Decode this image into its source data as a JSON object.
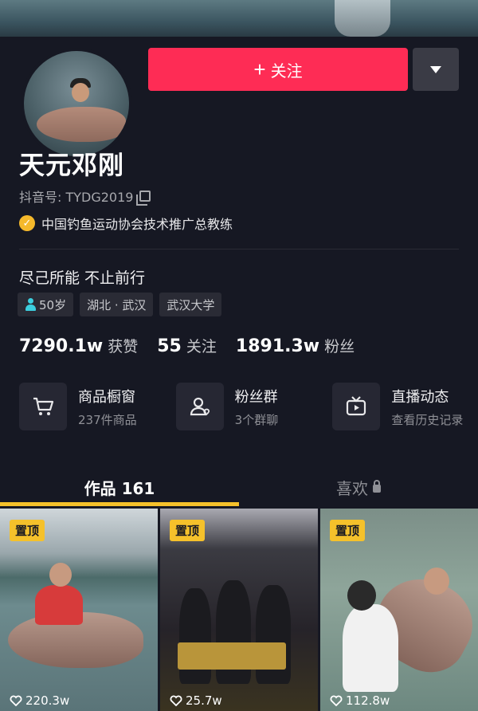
{
  "profile": {
    "name": "天元邓刚",
    "douyin_id": "抖音号: TYDG2019",
    "verification": "中国钓鱼运动协会技术推广总教练",
    "bio": "尽己所能 不止前行",
    "tags": [
      {
        "label": "50岁",
        "icon": "person-icon"
      },
      {
        "label": "湖北 · 武汉"
      },
      {
        "label": "武汉大学"
      }
    ]
  },
  "actions": {
    "follow_label": "关注",
    "follow_plus": "+"
  },
  "stats": [
    {
      "value": "7290.1w",
      "label": "获赞"
    },
    {
      "value": "55",
      "label": "关注"
    },
    {
      "value": "1891.3w",
      "label": "粉丝"
    }
  ],
  "services": [
    {
      "title": "商品橱窗",
      "subtitle": "237件商品",
      "icon": "cart-icon"
    },
    {
      "title": "粉丝群",
      "subtitle": "3个群聊",
      "icon": "group-icon"
    },
    {
      "title": "直播动态",
      "subtitle": "查看历史记录",
      "icon": "tv-icon"
    }
  ],
  "tabs": [
    {
      "label": "作品 161",
      "active": true
    },
    {
      "label": "喜欢",
      "locked": true
    }
  ],
  "videos": [
    {
      "pin": "置顶",
      "likes": "220.3w"
    },
    {
      "pin": "置顶",
      "likes": "25.7w"
    },
    {
      "pin": "置顶",
      "likes": "112.8w"
    }
  ],
  "colors": {
    "background": "#161823",
    "follow": "#fe2c55",
    "accent": "#f5c12b"
  }
}
